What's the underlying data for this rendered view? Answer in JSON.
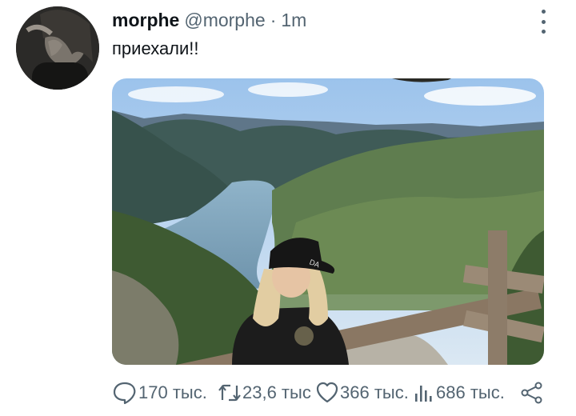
{
  "tweet": {
    "display_name": "morphe",
    "handle": "@morphe",
    "separator": "·",
    "time": "1m",
    "text": "приехали!!"
  },
  "actions": {
    "replies": "170 тыс.",
    "retweets": "23,6 тыс",
    "likes": "366 тыс.",
    "views": "686 тыс."
  },
  "icons": {
    "more": "more-vertical-icon",
    "reply": "speech-bubble-icon",
    "retweet": "retweet-icon",
    "like": "heart-icon",
    "views": "bar-chart-icon",
    "share": "share-icon"
  },
  "colors": {
    "text_primary": "#0f1419",
    "text_secondary": "#536471"
  }
}
